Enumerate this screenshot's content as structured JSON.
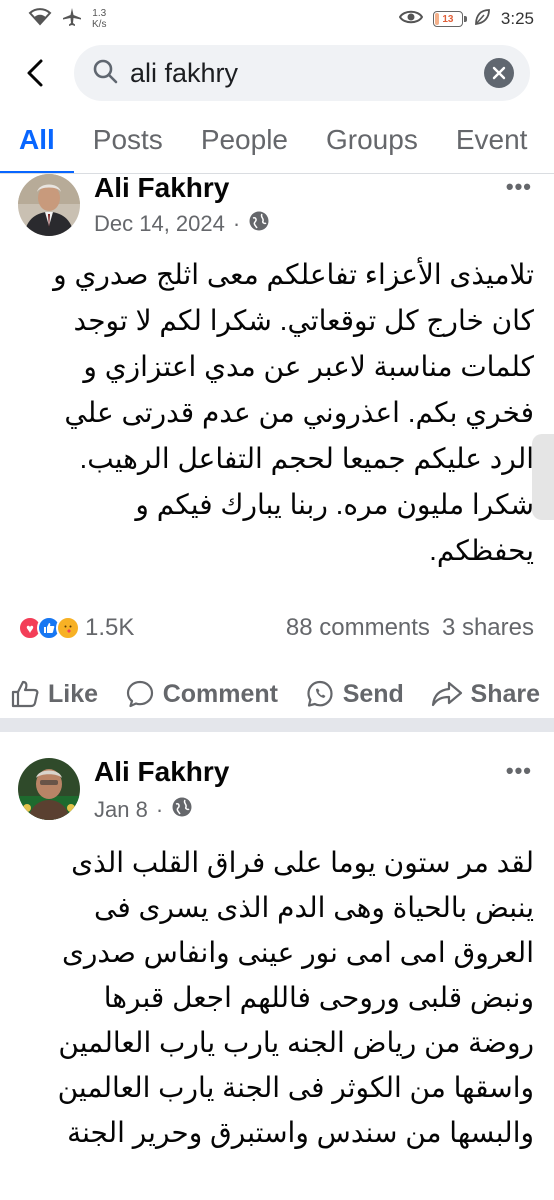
{
  "status_bar": {
    "network_speed_value": "1.3",
    "network_speed_unit": "K/s",
    "battery_level": "13",
    "battery_fraction": 0.13,
    "time": "3:25"
  },
  "search": {
    "query": "ali fakhry"
  },
  "tabs": [
    {
      "label": "All"
    },
    {
      "label": "Posts"
    },
    {
      "label": "People"
    },
    {
      "label": "Groups"
    },
    {
      "label": "Event"
    }
  ],
  "posts": [
    {
      "author": "Ali Fakhry",
      "date": "Dec 14, 2024",
      "separator": "·",
      "privacy_icon": "globe-icon",
      "text": "تلاميذى الأعزاء تفاعلكم معى اثلج صدري و\nكان خارج كل توقعاتي. شكرا لكم لا توجد\nكلمات مناسبة لاعبر عن مدي اعتزازي و\nفخري بكم. اعذروني من عدم قدرتى علي\nالرد عليكم جميعا لحجم التفاعل الرهيب.\nشكرا مليون مره.  ربنا يبارك فيكم و\nيحفظكم.",
      "reaction_count": "1.5K",
      "comments": "88 comments",
      "shares": "3 shares"
    },
    {
      "author": "Ali Fakhry",
      "date": "Jan 8",
      "separator": "·",
      "privacy_icon": "globe-icon",
      "text": "لقد مر ستون يوما على فراق القلب الذى\nينبض بالحياة وهى الدم الذى يسرى فى\nالعروق  امى امى نور عينى وانفاس صدرى\nونبض قلبى وروحى فاللهم اجعل قبرها\nروضة من رياض الجنه يارب يارب العالمين\nواسقها من الكوثر فى الجنة يارب العالمين\nوالبسها من سندس واستبرق وحرير  الجنة"
    }
  ],
  "actions": {
    "like": "Like",
    "comment": "Comment",
    "send": "Send",
    "share": "Share"
  },
  "colors": {
    "accent": "#0866ff",
    "secondary_text": "#65676b",
    "search_bg": "#f0f2f5",
    "separator": "#e4e6eb"
  }
}
